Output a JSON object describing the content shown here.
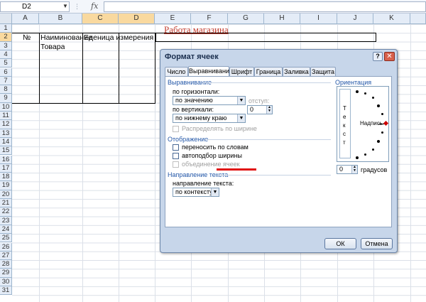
{
  "formula_bar": {
    "name_box": "D2",
    "fx_label": "fx",
    "formula": ""
  },
  "columns": [
    "A",
    "B",
    "C",
    "D",
    "E",
    "F",
    "G",
    "H",
    "I",
    "J",
    "K"
  ],
  "rows": [
    "1",
    "2",
    "3",
    "4",
    "5",
    "6",
    "7",
    "8",
    "9",
    "10",
    "11",
    "12",
    "13",
    "14",
    "15",
    "16",
    "17",
    "18",
    "19",
    "20",
    "21",
    "22",
    "23",
    "24",
    "25",
    "26",
    "27",
    "28",
    "29",
    "30",
    "31"
  ],
  "sheet": {
    "title": "Работа магазина",
    "a2": "№",
    "b2": "Наиминование",
    "c2": "Еденица измерения",
    "b3": "Товара"
  },
  "dialog": {
    "title": "Формат ячеек",
    "help": "?",
    "close": "✕",
    "tabs": [
      "Число",
      "Выравнивание",
      "Шрифт",
      "Граница",
      "Заливка",
      "Защита"
    ],
    "active_tab": "Выравнивание",
    "alignment_group": "Выравнивание",
    "horizontal_label": "по горизонтали:",
    "horizontal_value": "по значению",
    "indent_label": "отступ:",
    "indent_value": "0",
    "vertical_label": "по вертикали:",
    "vertical_value": "по нижнему краю",
    "distributed_label": "Распределять по ширине",
    "display_group": "Отображение",
    "wrap_label": "переносить по словам",
    "shrink_label": "автоподбор ширины",
    "merge_label": "объединение ячеек",
    "direction_group": "Направление текста",
    "direction_label": "направление текста:",
    "direction_value": "по контексту",
    "orientation_group": "Ориентация",
    "orientation_vertical_text": [
      "Т",
      "е",
      "к",
      "с",
      "т"
    ],
    "orientation_label": "Надпись",
    "degrees_value": "0",
    "degrees_label": "градусов",
    "ok": "ОК",
    "cancel": "Отмена"
  },
  "colors": {
    "accent_header": "#f9d99f",
    "annotation": "#e01010",
    "title_text": "#c0392b"
  }
}
